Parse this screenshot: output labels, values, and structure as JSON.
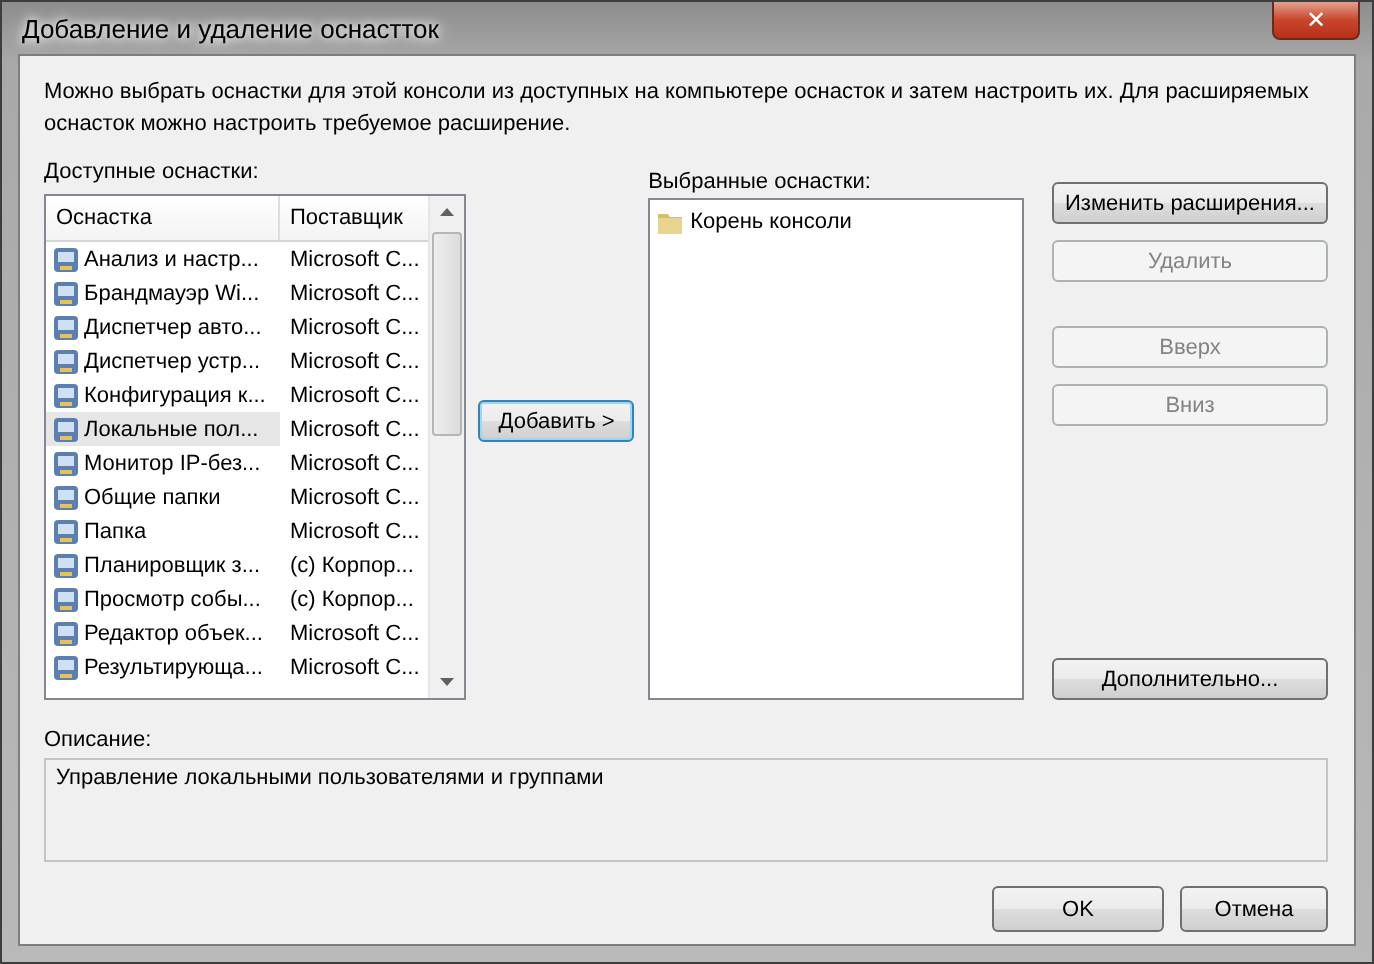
{
  "window": {
    "title": "Добавление и удаление оснастток",
    "close": "✕"
  },
  "intro": "Можно выбрать оснастки для этой консоли из доступных на компьютере оснасток и затем настроить их. Для расширяемых оснасток можно настроить требуемое расширение.",
  "available": {
    "label": "Доступные оснастки:",
    "columns": [
      "Оснастка",
      "Поставщик"
    ],
    "rows": [
      {
        "name": "Анализ и настр...",
        "vendor": "Microsoft C...",
        "selected": false
      },
      {
        "name": "Брандмауэр Wi...",
        "vendor": "Microsoft C...",
        "selected": false
      },
      {
        "name": "Диспетчер авто...",
        "vendor": "Microsoft C...",
        "selected": false
      },
      {
        "name": "Диспетчер устр...",
        "vendor": "Microsoft C...",
        "selected": false
      },
      {
        "name": "Конфигурация к...",
        "vendor": "Microsoft C...",
        "selected": false
      },
      {
        "name": "Локальные пол...",
        "vendor": "Microsoft C...",
        "selected": true
      },
      {
        "name": "Монитор IP-без...",
        "vendor": "Microsoft C...",
        "selected": false
      },
      {
        "name": "Общие папки",
        "vendor": "Microsoft C...",
        "selected": false
      },
      {
        "name": "Папка",
        "vendor": "Microsoft C...",
        "selected": false
      },
      {
        "name": "Планировщик з...",
        "vendor": "(c) Корпор...",
        "selected": false
      },
      {
        "name": "Просмотр собы...",
        "vendor": "(c) Корпор...",
        "selected": false
      },
      {
        "name": "Редактор объек...",
        "vendor": "Microsoft C...",
        "selected": false
      },
      {
        "name": "Результирующа...",
        "vendor": "Microsoft C...",
        "selected": false
      }
    ]
  },
  "add_button": "Добавить >",
  "selected_list": {
    "label": "Выбранные оснастки:",
    "items": [
      {
        "name": "Корень консоли",
        "selected": false
      }
    ]
  },
  "side_buttons": [
    {
      "label": "Изменить расширения...",
      "disabled": false
    },
    {
      "label": "Удалить",
      "disabled": true
    },
    {
      "label": "Вверх",
      "disabled": true
    },
    {
      "label": "Вниз",
      "disabled": true
    },
    {
      "label": "Дополнительно...",
      "disabled": false
    }
  ],
  "description": {
    "label": "Описание:",
    "text": "Управление локальными пользователями и группами"
  },
  "buttons": [
    "OK",
    "Отмена"
  ]
}
